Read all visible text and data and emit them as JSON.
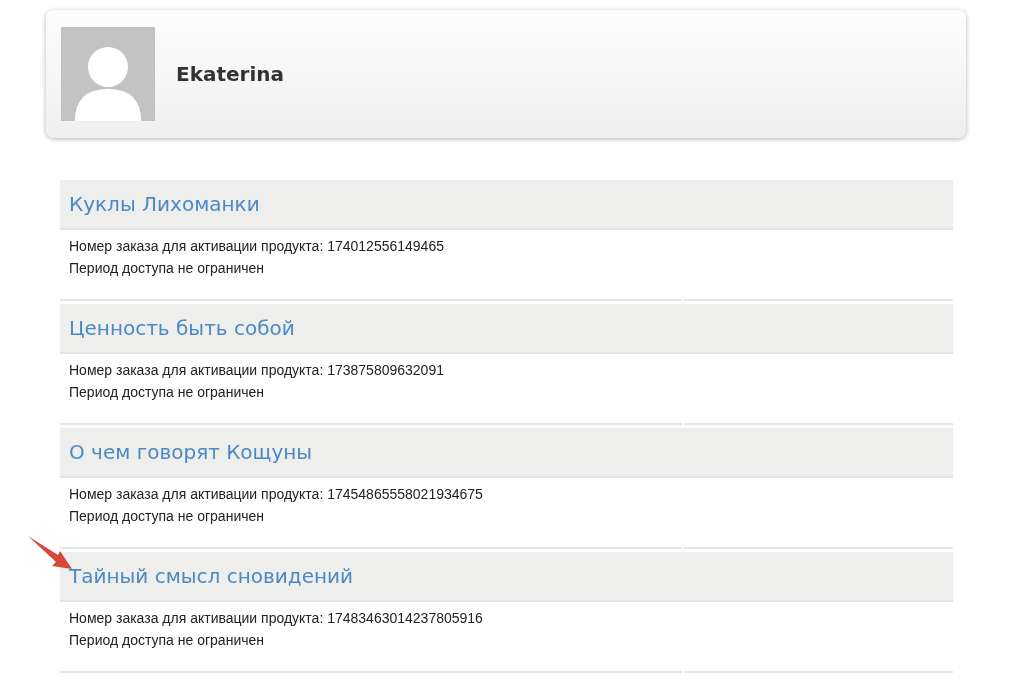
{
  "profile": {
    "name": "Ekaterina"
  },
  "products": [
    {
      "title": "Куклы Лихоманки",
      "order": "Номер заказа для активации продукта: 174012556149465",
      "access": "Период доступа не ограничен",
      "highlighted": false
    },
    {
      "title": "Ценность быть собой",
      "order": "Номер заказа для активации продукта: 173875809632091",
      "access": "Период доступа не ограничен",
      "highlighted": false
    },
    {
      "title": "О чем говорят Кощуны",
      "order": "Номер заказа для активации продукта: 17454865558021934675",
      "access": "Период доступа не ограничен",
      "highlighted": false
    },
    {
      "title": "Тайный смысл сновидений",
      "order": "Номер заказа для активации продукта: 17483463014237805916",
      "access": "Период доступа не ограничен",
      "highlighted": true
    }
  ]
}
